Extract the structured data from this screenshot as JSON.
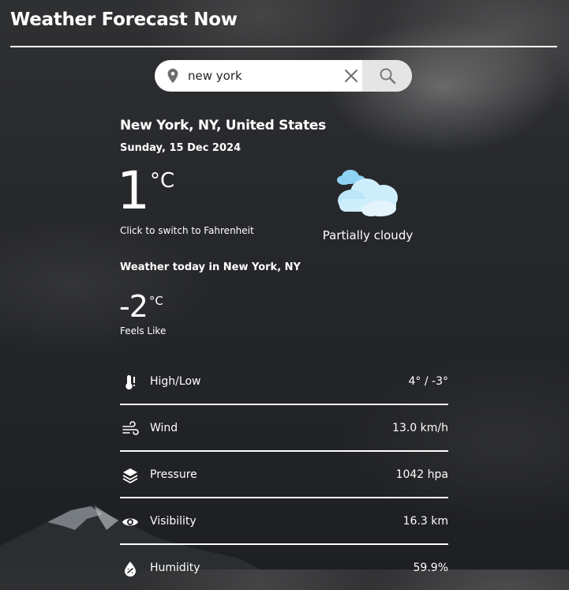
{
  "app": {
    "title": "Weather Forecast Now"
  },
  "search": {
    "value": "new york",
    "placeholder": ""
  },
  "current": {
    "location": "New York, NY, United States",
    "date": "Sunday, 15 Dec 2024",
    "temperature": "1",
    "unit": "°C",
    "unit_hint": "Click to switch to Fahrenheit",
    "condition": "Partially cloudy",
    "condition_icon": "partly-cloudy-icon"
  },
  "today": {
    "heading": "Weather today in New York, NY",
    "feels_like": "-2",
    "feels_unit": "°C",
    "feels_label": "Feels Like"
  },
  "details": [
    {
      "icon": "thermometer-icon",
      "label": "High/Low",
      "value": "4° / -3°"
    },
    {
      "icon": "wind-icon",
      "label": "Wind",
      "value": "13.0 km/h"
    },
    {
      "icon": "layers-icon",
      "label": "Pressure",
      "value": "1042 hpa"
    },
    {
      "icon": "eye-icon",
      "label": "Visibility",
      "value": "16.3 km"
    },
    {
      "icon": "droplet-icon",
      "label": "Humidity",
      "value": "59.9%"
    }
  ],
  "colors": {
    "text": "#ffffff",
    "search_bg": "#ffffff",
    "search_button_bg": "#e5e5e5",
    "cloud_light": "#cfeefb",
    "cloud_blue": "#8fd3f4"
  }
}
